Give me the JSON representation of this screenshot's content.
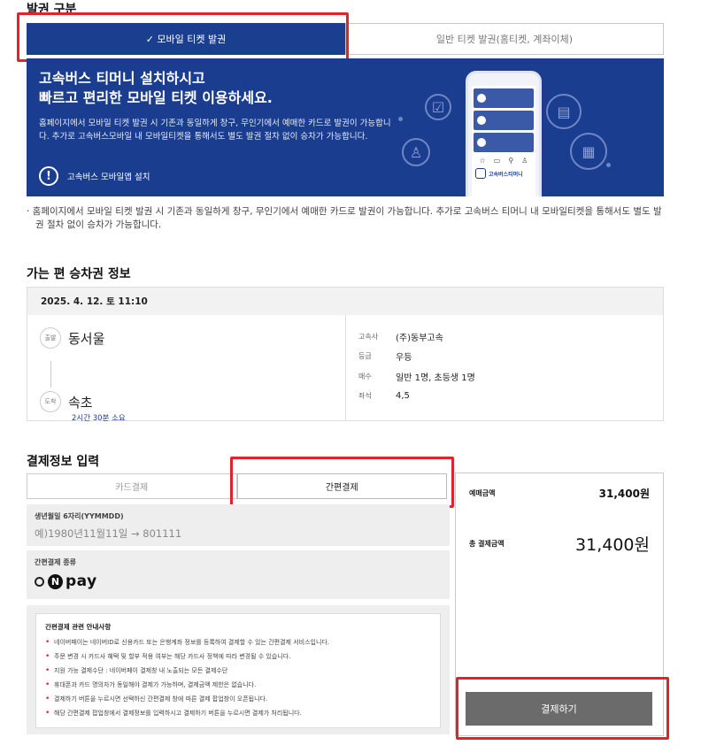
{
  "ticket_section": {
    "title": "발권 구분",
    "tabs": [
      {
        "label": "✓ 모바일 티켓 발권",
        "active": true
      },
      {
        "label": "일반 티켓 발권(홈티켓, 계좌이체)",
        "active": false
      }
    ]
  },
  "banner": {
    "headline_1": "고속버스 티머니 설치하시고",
    "headline_2": "빠르고 편리한 모바일 티켓 이용하세요.",
    "description": "홈페이지에서 모바일 티켓 발권 시 기존과 동일하게 창구, 무인기에서 예매한 카드로 발권이 가능합니다. 추가로 고속버스모바일 내 모바일티켓을 통해서도 별도 발권 절차 없이 승차가 가능합니다.",
    "install_link": "고속버스 모바일앱 설치",
    "phone_brand": "고속버스티머니",
    "colors": {
      "background": "#1a3d8f"
    }
  },
  "notice": "· 홈페이지에서 모바일 티켓 발권 시 기존과 동일하게 창구, 무인기에서 예매한 카드로 발권이 가능합니다. 추가로 고속버스 티머니 내 모바일티켓을 통해서도 별도 발권 절차 없이 승차가 가능합니다.",
  "trip": {
    "title": "가는 편 승차권 정보",
    "datetime": "2025. 4. 12. 토 11:10",
    "departure_badge": "출발",
    "departure": "동서울",
    "arrival_badge": "도착",
    "arrival": "속초",
    "duration": "2시간 30분 소요",
    "info": [
      {
        "label": "고속사",
        "value": "(주)동부고속"
      },
      {
        "label": "등급",
        "value": "우등"
      },
      {
        "label": "매수",
        "value": "일반 1명, 초등생 1명"
      },
      {
        "label": "좌석",
        "value": "4,5"
      }
    ]
  },
  "payment": {
    "title": "결제정보 입력",
    "tabs": [
      {
        "label": "카드결제",
        "active": false
      },
      {
        "label": "간편결제",
        "active": true
      }
    ],
    "birth_label": "생년월일 6자리(YYMMDD)",
    "birth_placeholder": "예)1980년11월11일 → 801111",
    "type_label": "간편결제 종류",
    "npay_n": "N",
    "npay_text": "pay",
    "guide_title": "간편결제 관련 안내사항",
    "guide_items": [
      "네이버페이는 네이버ID로 신용카드 또는 은행계좌 정보를 등록하여 결제할 수 있는 간편결제 서비스입니다.",
      "주문 변경 시 카드사 혜택 및 할부 적용 여부는 해당 카드사 정책에 따라 변경될 수 있습니다.",
      "지원 가능 결제수단 : 네이버페이 결제창 내 노출되는 모든 결제수단",
      "휴대폰과 카드 명의자가 동일해야 결제가 가능하며, 결제금액 제한은 없습니다.",
      "결제하기 버튼을 누르시면 선택하신 간편결제 창에 따른 결제 팝업창이 오픈됩니다.",
      "해당 간편결제 팝업창에서 결제정보를 입력하시고 결제하기 버튼을 누르시면 결제가 처리됩니다."
    ],
    "summary": {
      "booking_label": "예매금액",
      "booking_amount": "31,400원",
      "total_label": "총 결제금액",
      "total_amount": "31,400원"
    },
    "pay_button": "결제하기"
  },
  "colors": {
    "highlight": "#e0242b",
    "primary": "#1b3f8f",
    "button": "#6b6b6b"
  }
}
